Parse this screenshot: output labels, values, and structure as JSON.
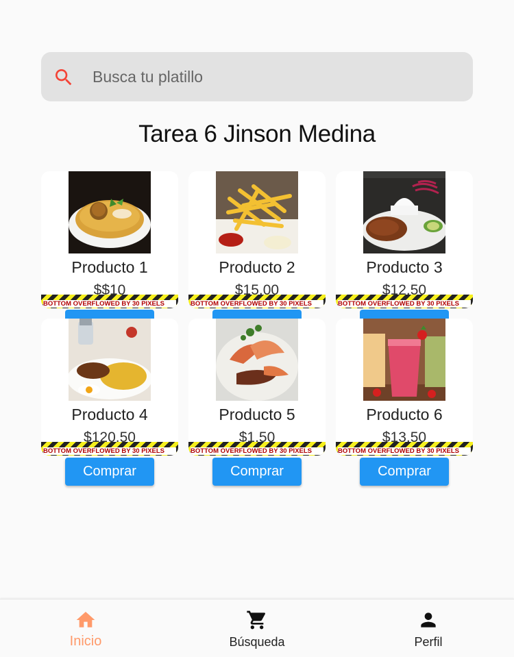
{
  "search": {
    "placeholder": "Busca tu platillo",
    "icon": "search-icon"
  },
  "title": "Tarea 6 Jinson Medina",
  "overflow_message": "BOTTOM OVERFLOWED BY 30 PIXELS",
  "buy_label": "Comprar",
  "products": [
    {
      "name": "Producto 1",
      "price": "$$10",
      "image": "yellow stew with fish and plantain ball in white bowl"
    },
    {
      "name": "Producto 2",
      "price": "$15.00",
      "image": "french fries with ketchup and mayo"
    },
    {
      "name": "Producto 3",
      "price": "$12.50",
      "image": "rice, beef stew, avocado and onion salad"
    },
    {
      "name": "Producto 4",
      "price": "$120.50",
      "image": "plate with rice, meat and fried egg"
    },
    {
      "name": "Producto 5",
      "price": "$1.50",
      "image": "grilled seafood plate with shrimp and herbs"
    },
    {
      "name": "Producto 6",
      "price": "$13.50",
      "image": "fruit smoothies with strawberries"
    }
  ],
  "nav": [
    {
      "label": "Inicio",
      "icon": "home-icon",
      "active": true
    },
    {
      "label": "Búsqueda",
      "icon": "cart-icon",
      "active": false
    },
    {
      "label": "Perfil",
      "icon": "person-icon",
      "active": false
    }
  ],
  "colors": {
    "accent": "#2196f3",
    "active_nav": "#ff9a6a",
    "search_icon": "#f44336"
  }
}
